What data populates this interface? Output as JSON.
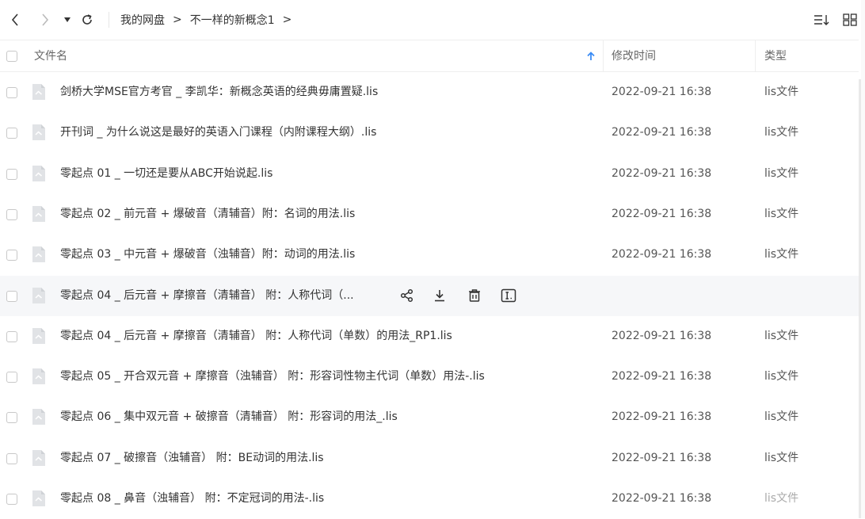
{
  "toolbar": {
    "breadcrumb": [
      "我的网盘",
      "不一样的新概念1"
    ],
    "sep": ">"
  },
  "columns": {
    "name": "文件名",
    "modified": "修改时间",
    "type": "类型"
  },
  "files": [
    {
      "name": "剑桥大学MSE官方考官 _ 李凯华：新概念英语的经典毋庸置疑.lis",
      "date": "2022-09-21 16:38",
      "type": "lis文件"
    },
    {
      "name": "开刊词 _ 为什么说这是最好的英语入门课程（内附课程大纲）.lis",
      "date": "2022-09-21 16:38",
      "type": "lis文件"
    },
    {
      "name": "零起点 01 _ 一切还是要从ABC开始说起.lis",
      "date": "2022-09-21 16:38",
      "type": "lis文件"
    },
    {
      "name": "零起点 02 _ 前元音 + 爆破音（清辅音）附：名词的用法.lis",
      "date": "2022-09-21 16:38",
      "type": "lis文件"
    },
    {
      "name": "零起点 03 _ 中元音 + 爆破音（浊辅音）附：动词的用法.lis",
      "date": "2022-09-21 16:38",
      "type": "lis文件"
    },
    {
      "name": "零起点 04 _ 后元音 + 摩擦音（清辅音） 附：人称代词（...",
      "date": "",
      "type": ""
    },
    {
      "name": "零起点 04 _ 后元音 + 摩擦音（清辅音） 附：人称代词（单数）的用法_RP1.lis",
      "date": "2022-09-21 16:38",
      "type": "lis文件"
    },
    {
      "name": "零起点 05 _ 开合双元音 + 摩擦音（浊辅音） 附：形容词性物主代词（单数）用法-.lis",
      "date": "2022-09-21 16:38",
      "type": "lis文件"
    },
    {
      "name": "零起点 06 _ 集中双元音 + 破擦音（清辅音） 附：形容词的用法_.lis",
      "date": "2022-09-21 16:38",
      "type": "lis文件"
    },
    {
      "name": "零起点 07 _ 破擦音（浊辅音） 附：BE动词的用法.lis",
      "date": "2022-09-21 16:38",
      "type": "lis文件"
    },
    {
      "name": "零起点 08 _ 鼻音（浊辅音） 附：不定冠词的用法-.lis",
      "date": "2022-09-21 16:38",
      "type": "lis文件"
    }
  ],
  "hover_row_index": 5,
  "hover_actions": [
    "share-icon",
    "download-icon",
    "delete-icon",
    "rename-icon"
  ],
  "icons": {
    "back": "chevron-left-icon",
    "forward": "chevron-right-icon",
    "dropdown": "caret-down-icon",
    "refresh": "refresh-icon",
    "sort": "sort-list-icon",
    "grid": "grid-view-icon",
    "file": "file-icon"
  },
  "colors": {
    "accent": "#3b8cf5",
    "hover_bg": "#f6f7f9",
    "border": "#eeeeee"
  }
}
